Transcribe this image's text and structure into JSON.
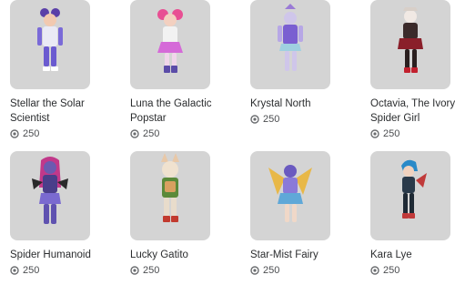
{
  "catalog": {
    "items": [
      {
        "name": "Stellar the Solar Scientist",
        "price": "250",
        "currency_icon": "robux-icon"
      },
      {
        "name": "Luna the Galactic Popstar",
        "price": "250",
        "currency_icon": "robux-icon"
      },
      {
        "name": "Krystal North",
        "price": "250",
        "currency_icon": "robux-icon"
      },
      {
        "name": "Octavia, The Ivory Spider Girl",
        "price": "250",
        "currency_icon": "robux-icon"
      },
      {
        "name": "Spider Humanoid",
        "price": "250",
        "currency_icon": "robux-icon"
      },
      {
        "name": "Lucky Gatito",
        "price": "250",
        "currency_icon": "robux-icon"
      },
      {
        "name": "Star-Mist Fairy",
        "price": "250",
        "currency_icon": "robux-icon"
      },
      {
        "name": "Kara Lye",
        "price": "250",
        "currency_icon": "robux-icon"
      }
    ]
  },
  "colors": {
    "thumb_bg": "#d4d4d4",
    "text": "#2b2d2f",
    "price_text": "#4b4d50"
  }
}
